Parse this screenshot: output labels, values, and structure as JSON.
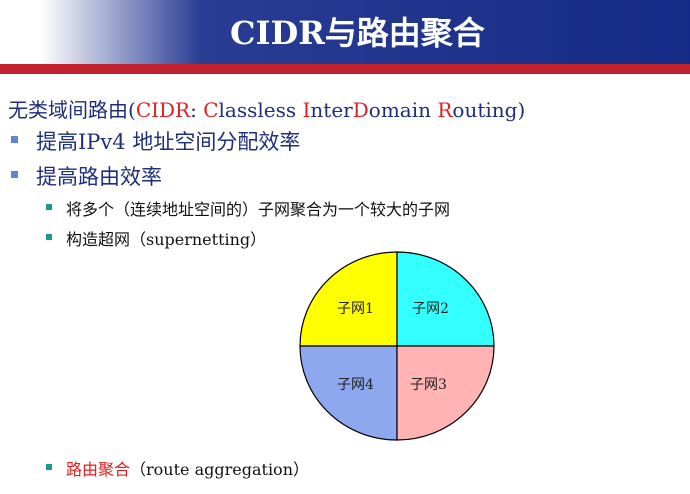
{
  "header": {
    "title": "CIDR与路由聚合"
  },
  "content": {
    "line1": {
      "prefix": "无类域间路由(",
      "cidr": "CIDR",
      "colon": ": ",
      "C": "C",
      "w1": "lassless ",
      "I": "I",
      "w2": "nter",
      "D": "D",
      "w3": "omain ",
      "R": "R",
      "w4": "outing)"
    },
    "bullet1": "提高IPv4 地址空间分配效率",
    "bullet2": "提高路由效率",
    "sub1": "将多个（连续地址空间的）子网聚合为一个较大的子网",
    "sub2": "构造超网（supernetting）",
    "sub3": {
      "highlight": "路由聚合",
      "rest": "（route aggregation）"
    }
  },
  "diagram": {
    "quadrants": [
      {
        "label": "子网1",
        "color": "#ffff00"
      },
      {
        "label": "子网2",
        "color": "#33ffff"
      },
      {
        "label": "子网4",
        "color": "#8ea8f0"
      },
      {
        "label": "子网3",
        "color": "#ffb3b3"
      }
    ]
  },
  "colors": {
    "header_bg": "#152a86",
    "accent_red": "#c0232f",
    "text_blue": "#1f2f7a",
    "highlight_red": "#e02020"
  }
}
